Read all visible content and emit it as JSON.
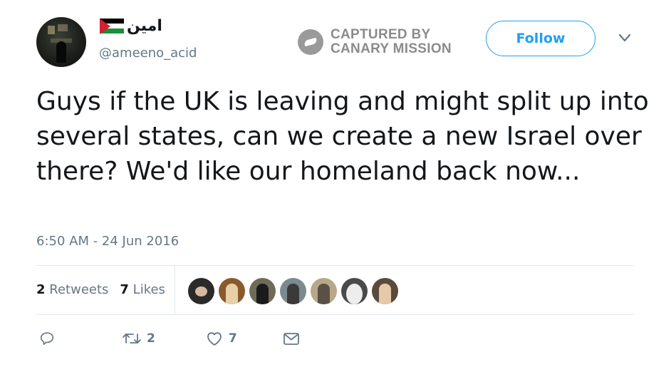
{
  "profile": {
    "display_name": "امين",
    "handle": "@ameeno_acid"
  },
  "watermark": {
    "line1": "CAPTURED BY",
    "line2": "CANARY MISSION"
  },
  "follow_label": "Follow",
  "tweet": {
    "text": "Guys if the UK is leaving and might split up into several states, can we create a new Israel over there? We'd like our homeland back now...",
    "timestamp": "6:50 AM - 24 Jun 2016"
  },
  "stats": {
    "retweets_count": "2",
    "retweets_label": "Retweets",
    "likes_count": "7",
    "likes_label": "Likes"
  },
  "actions": {
    "reply_count": "",
    "retweet_count": "2",
    "like_count": "7"
  },
  "colors": {
    "accent": "#1da1f2",
    "secondary_text": "#657786",
    "divider": "#e1e8ed",
    "watermark": "#8b8b8b"
  },
  "icons": [
    "reply-icon",
    "retweet-icon",
    "like-icon",
    "message-icon",
    "chevron-down-icon",
    "canary-mission-logo",
    "palestine-flag-icon"
  ]
}
